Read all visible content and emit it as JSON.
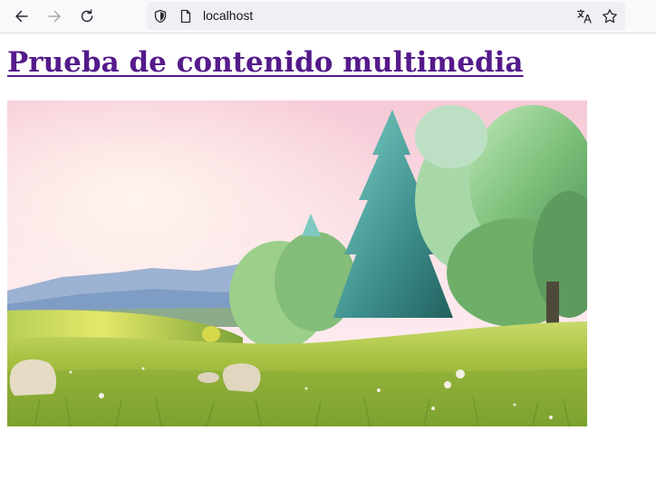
{
  "browser": {
    "url": "localhost",
    "icons": {
      "back": "arrow-left-icon",
      "forward": "arrow-right-icon",
      "reload": "reload-icon",
      "security": "shield-icon",
      "page": "page-icon",
      "translate": "translate-icon",
      "bookmark": "star-icon"
    }
  },
  "page": {
    "heading": "Prueba de contenido multimedia",
    "link_color": "#551a8b"
  }
}
